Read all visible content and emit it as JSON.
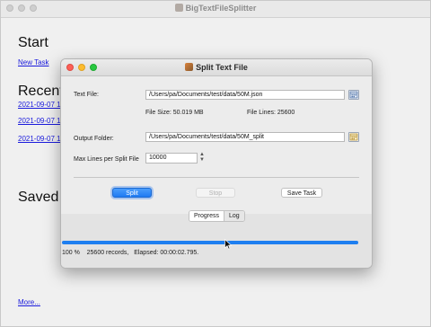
{
  "main_window": {
    "title": "BigTextFileSplitter",
    "start_heading": "Start",
    "new_task_link": "New Task",
    "recent_heading": "Recent",
    "recent_items": [
      "2021-09-07 1",
      "2021-09-07 1",
      "2021-09-07 1"
    ],
    "saved_heading": "Saved T",
    "more_link": "More..."
  },
  "dialog": {
    "title": "Split Text File",
    "text_file_label": "Text File:",
    "text_file_value": "/Users/pa/Documents/test/data/50M.json",
    "file_size": "File Size: 50.019 MB",
    "file_lines": "File Lines: 25600",
    "output_folder_label": "Output Folder:",
    "output_folder_value": "/Users/pa/Documents/test/data/50M_split",
    "max_lines_label": "Max Lines per Split File",
    "max_lines_value": "10000",
    "buttons": {
      "split": "Split",
      "stop": "Stop",
      "save_task": "Save Task"
    },
    "tabs": {
      "progress": "Progress",
      "log": "Log"
    },
    "progress": {
      "fraction": 1.0,
      "percent_text": "100 %",
      "records_text": "25600 records,",
      "elapsed_text": "Elapsed: 00:00:02.795."
    }
  },
  "icons": {
    "browse": "folder-browse-icon",
    "cursor": "mouse-pointer-icon"
  },
  "colors": {
    "accent": "#1f7af2",
    "link": "#1a1adc",
    "close": "#fc5f57",
    "minimize": "#fdbc2e",
    "zoom": "#28c840"
  }
}
